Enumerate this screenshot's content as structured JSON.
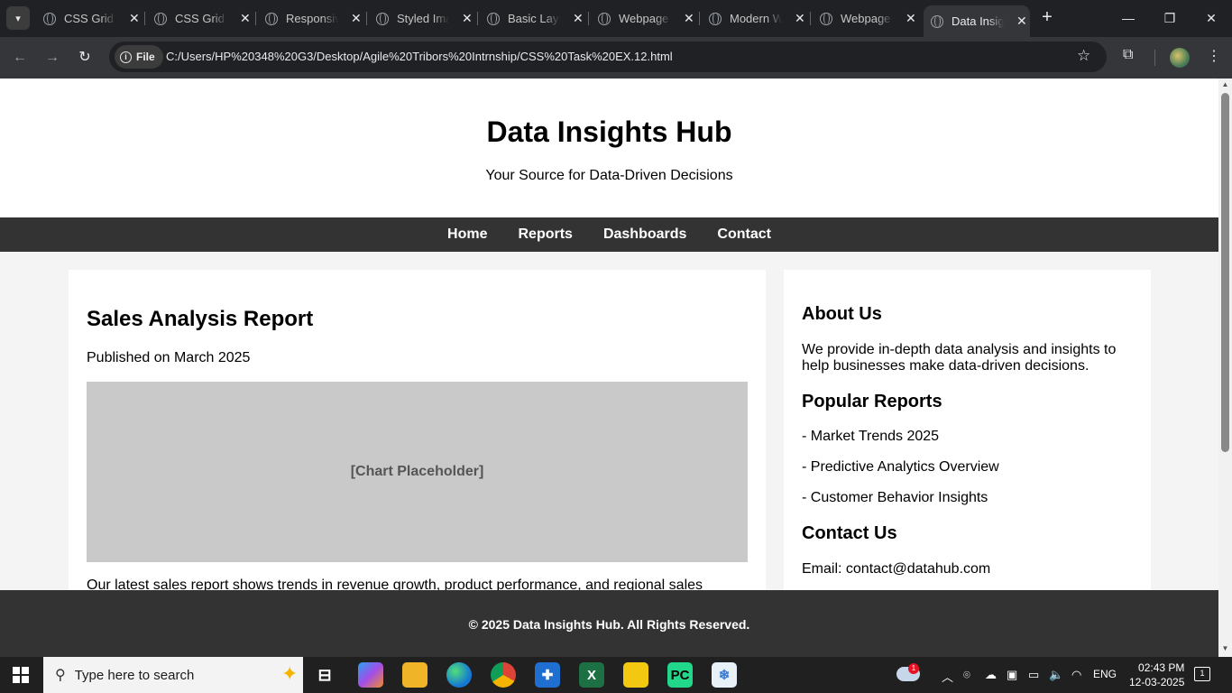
{
  "browser": {
    "tabs": [
      {
        "title": "CSS Grid Layout"
      },
      {
        "title": "CSS Grid Layout"
      },
      {
        "title": "Responsive Layout"
      },
      {
        "title": "Styled Image"
      },
      {
        "title": "Basic Layout"
      },
      {
        "title": "Webpage"
      },
      {
        "title": "Modern Webpage"
      },
      {
        "title": "Webpage"
      },
      {
        "title": "Data Insights Hub"
      }
    ],
    "active_tab_index": 8,
    "address": {
      "chip_label": "File",
      "url": "C:/Users/HP%20348%20G3/Desktop/Agile%20Tribors%20Intrnship/CSS%20Task%20EX.12.html"
    }
  },
  "site": {
    "title": "Data Insights Hub",
    "subtitle": "Your Source for Data-Driven Decisions",
    "nav": [
      "Home",
      "Reports",
      "Dashboards",
      "Contact"
    ],
    "main": {
      "heading": "Sales Analysis Report",
      "published": "Published on March 2025",
      "chart_placeholder": "[Chart Placeholder]",
      "text": "Our latest sales report shows trends in revenue growth, product performance, and regional sales"
    },
    "sidebar": {
      "about_title": "About Us",
      "about_text": "We provide in-depth data analysis and insights to help businesses make data-driven decisions.",
      "popular_title": "Popular Reports",
      "popular_items": [
        "- Market Trends 2025",
        "- Predictive Analytics Overview",
        "- Customer Behavior Insights"
      ],
      "contact_title": "Contact Us",
      "email": "Email: contact@datahub.com"
    },
    "footer": "© 2025 Data Insights Hub. All Rights Reserved."
  },
  "taskbar": {
    "search_placeholder": "Type here to search",
    "language": "ENG",
    "time": "02:43 PM",
    "date": "12-03-2025",
    "weather_badge": "1",
    "notifications": "1"
  },
  "colors": {
    "nav_bg": "#333333",
    "chart_bg": "#c9c9c9",
    "page_bg": "#f4f4f4",
    "chrome_dark": "#202124"
  }
}
